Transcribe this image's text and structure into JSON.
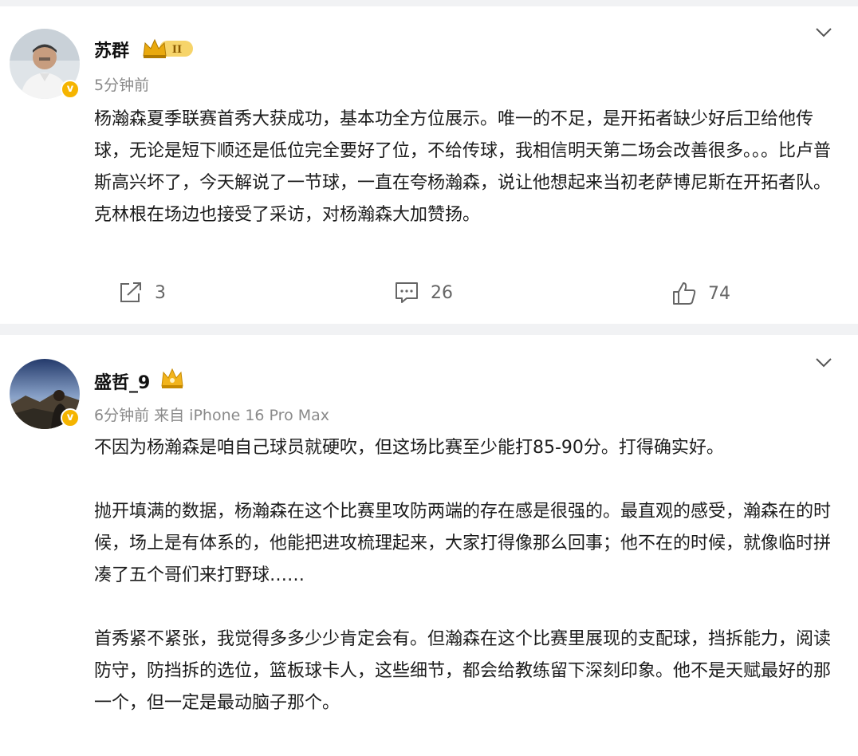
{
  "posts": [
    {
      "author": "苏群",
      "rank_badge": "II",
      "time": "5分钟前",
      "paragraphs": [
        "杨瀚森夏季联赛首秀大获成功，基本功全方位展示。唯一的不足，是开拓者缺少好后卫给他传球，无论是短下顺还是低位完全要好了位，不给传球，我相信明天第二场会改善很多。。。比卢普斯高兴坏了，今天解说了一节球，一直在夸杨瀚森，说让他想起来当初老萨博尼斯在开拓者队。克林根在场边也接受了采访，对杨瀚森大加赞扬。"
      ],
      "actions": {
        "share_count": "3",
        "comment_count": "26",
        "like_count": "74"
      },
      "verified_mark": "v"
    },
    {
      "author": "盛哲_9",
      "time": "6分钟前 来自 iPhone 16 Pro Max",
      "paragraphs": [
        "不因为杨瀚森是咱自己球员就硬吹，但这场比赛至少能打85-90分。打得确实好。",
        "抛开填满的数据，杨瀚森在这个比赛里攻防两端的存在感是很强的。最直观的感受，瀚森在的时候，场上是有体系的，他能把进攻梳理起来，大家打得像那么回事；他不在的时候，就像临时拼凑了五个哥们来打野球……",
        "首秀紧不紧张，我觉得多多少少肯定会有。但瀚森在这个比赛里展现的支配球，挡拆能力，阅读防守，防挡拆的选位，篮板球卡人，这些细节，都会给教练留下深刻印象。他不是天赋最好的那一个，但一定是最动脑子那个。"
      ],
      "verified_mark": "v"
    }
  ],
  "colors": {
    "badge_gold": "#f5b400",
    "separator": "#f1f2f4",
    "meta_text": "#8a8a8a"
  }
}
